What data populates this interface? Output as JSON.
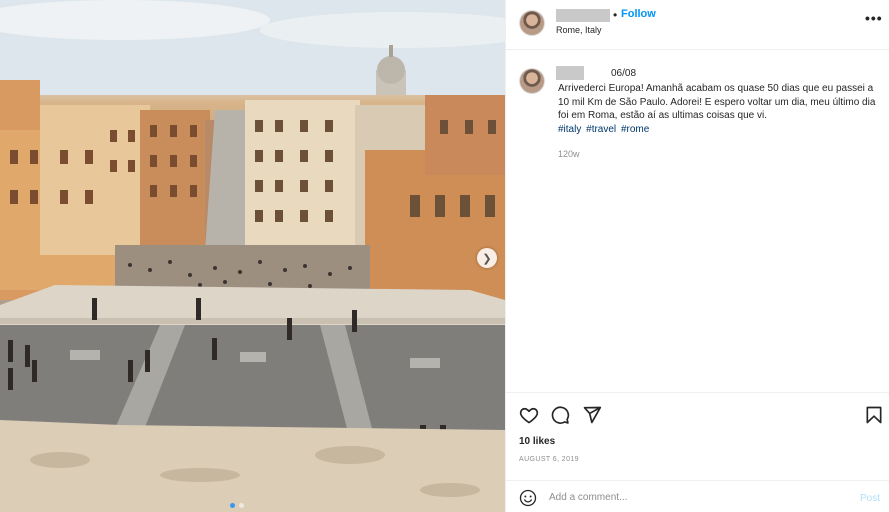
{
  "post": {
    "photo_alt": "",
    "carousel_count": 2,
    "carousel_active": 1
  },
  "header": {
    "separator": "•",
    "follow_label": "Follow",
    "location": "Rome, Italy",
    "more_icon": "more-dots-icon",
    "more_glyph": "•••"
  },
  "caption": {
    "date": "06/08",
    "text": "Arrivederci Europa! Amanhã acabam os quase 50 dias que eu passei a 10 mil Km de São Paulo. Adorei! E espero voltar um dia, meu último dia foi em Roma, estão aí as ultimas coisas que vi.",
    "hashtags": [
      "#italy",
      "#travel",
      "#rome"
    ],
    "time_ago": "120w"
  },
  "actions": {
    "icons": [
      "heart-icon",
      "comment-icon",
      "share-icon",
      "bookmark-icon"
    ]
  },
  "likes": "10 likes",
  "post_date": "AUGUST 6, 2019",
  "comment_box": {
    "placeholder": "Add a comment...",
    "post_label": "Post",
    "emoji_icon": "emoji-icon"
  },
  "colors": {
    "link_blue": "#0095f6",
    "hashtag_blue": "#00376b",
    "post_disabled": "#b2dffc",
    "muted_text": "#8e8e8e"
  }
}
